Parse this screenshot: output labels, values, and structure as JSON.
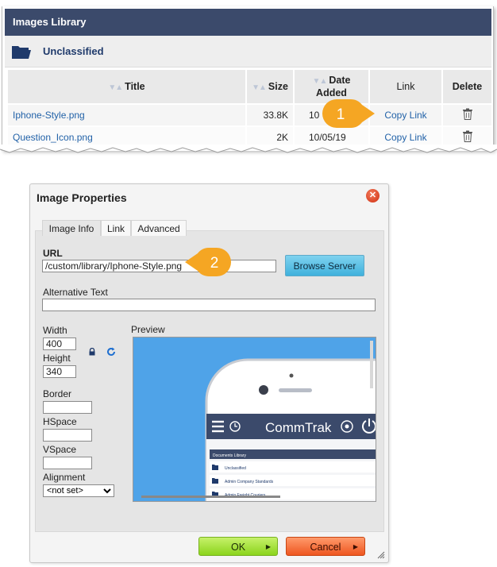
{
  "library": {
    "title": "Images Library",
    "folder": "Unclassified",
    "columns": {
      "title": "Title",
      "size": "Size",
      "date_line1": "Date",
      "date_line2": "Added",
      "link": "Link",
      "delete": "Delete"
    },
    "rows": [
      {
        "name": "Iphone-Style.png",
        "size": "33.8K",
        "date": "10",
        "link": "Copy Link"
      },
      {
        "name": "Question_Icon.png",
        "size": "2K",
        "date": "10/05/19",
        "link": "Copy Link"
      }
    ]
  },
  "callouts": [
    "1",
    "2"
  ],
  "dialog": {
    "title": "Image Properties",
    "tabs": [
      "Image Info",
      "Link",
      "Advanced"
    ],
    "url_label": "URL",
    "url_value": "/custom/library/Iphone-Style.png",
    "browse_label": "Browse Server",
    "alt_label": "Alternative Text",
    "alt_value": "",
    "width_label": "Width",
    "width_value": "400",
    "height_label": "Height",
    "height_value": "340",
    "border_label": "Border",
    "hspace_label": "HSpace",
    "vspace_label": "VSpace",
    "alignment_label": "Alignment",
    "alignment_value": "<not set>",
    "preview_label": "Preview",
    "ok_label": "OK",
    "cancel_label": "Cancel"
  },
  "preview": {
    "brand": "CommTrak",
    "section": "Documents Library",
    "items": [
      "Unclassified",
      "Admin Company Standards",
      "Admin Freight Couriers"
    ]
  },
  "colors": {
    "header_bg": "#3b4a6b",
    "link": "#2262a8",
    "callout": "#f5a623",
    "preview_bg": "#4fa3e8"
  }
}
